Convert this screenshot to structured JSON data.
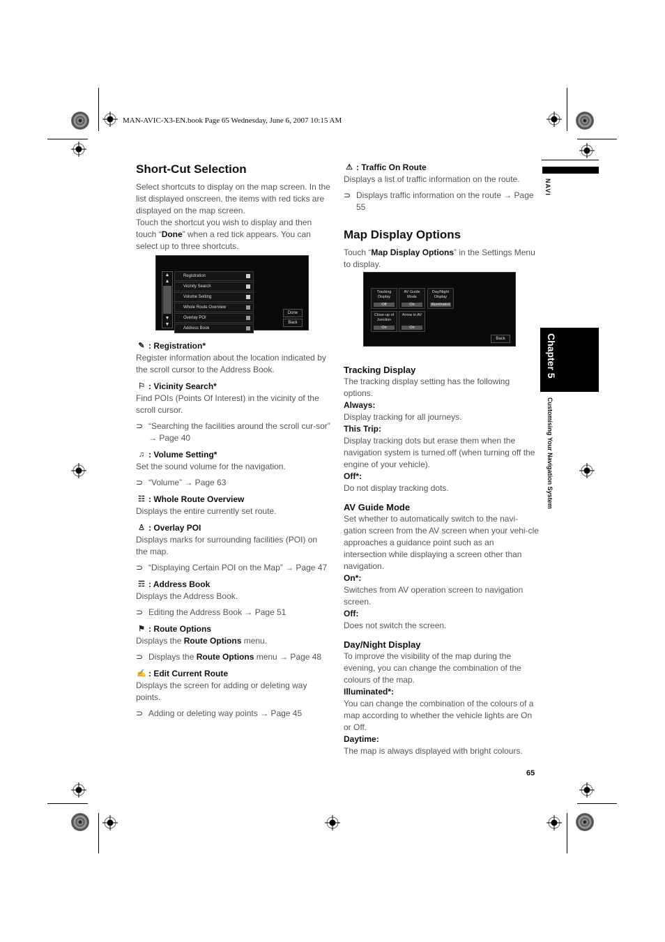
{
  "header": {
    "print_line": "MAN-AVIC-X3-EN.book  Page 65  Wednesday, June 6, 2007  10:15 AM"
  },
  "side": {
    "navi": "NAVI",
    "chapter": "Chapter 5",
    "section": "Customising Your Navigation System"
  },
  "page_number": "65",
  "shortcut": {
    "title": "Short-Cut Selection",
    "intro_1": "Select shortcuts to display on the map screen. In the list displayed onscreen, the items with red ticks are displayed on the map screen.",
    "intro_2_pre": "Touch the shortcut you wish to display and then touch “",
    "intro_2_bold": "Done",
    "intro_2_post": "” when a red tick appears. You can select up to three shortcuts.",
    "screen": {
      "rows": [
        {
          "label": "Registration",
          "checked": true
        },
        {
          "label": "Vicinity Search",
          "checked": true
        },
        {
          "label": "Volume Setting",
          "checked": true
        },
        {
          "label": "Whole Route Overview",
          "checked": false
        },
        {
          "label": "Overlay POI",
          "checked": false
        },
        {
          "label": "Address Book",
          "checked": false
        }
      ],
      "done": "Done",
      "back": "Back"
    },
    "items": [
      {
        "icon": "registration-icon",
        "glyph": "✎",
        "title": ": Registration*",
        "desc": "Register information about the location indicated by the scroll cursor to the Address Book."
      },
      {
        "icon": "vicinity-search-icon",
        "glyph": "⚐",
        "title": ": Vicinity Search*",
        "desc": "Find POIs (Points Of Interest) in the vicinity of the scroll cursor.",
        "ref": "“Searching the facilities around the scroll cur-sor” → Page 40"
      },
      {
        "icon": "volume-setting-icon",
        "glyph": "♫",
        "title": ": Volume Setting*",
        "desc": "Set the sound volume for the navigation.",
        "ref": "“Volume” → Page 63"
      },
      {
        "icon": "whole-route-overview-icon",
        "glyph": "☷",
        "title": ": Whole Route Overview",
        "desc": "Displays the entire currently set route."
      },
      {
        "icon": "overlay-poi-icon",
        "glyph": "♙",
        "title": " : Overlay POI",
        "desc": "Displays marks for surrounding facilities (POI) on the map.",
        "ref": "“Displaying Certain POI on the Map” → Page 47"
      },
      {
        "icon": "address-book-icon",
        "glyph": "☶",
        "title": ": Address Book",
        "desc": "Displays the Address Book.",
        "ref": "Editing the Address Book → Page 51"
      },
      {
        "icon": "route-options-icon",
        "glyph": "⚑",
        "title": ": Route Options",
        "desc_pre": "Displays the ",
        "desc_bold": "Route Options",
        "desc_post": " menu.",
        "ref_pre": "Displays the ",
        "ref_bold": "Route Options",
        "ref_post": " menu → Page 48"
      },
      {
        "icon": "edit-current-route-icon",
        "glyph": "✍",
        "title": ": Edit Current Route",
        "desc": "Displays the screen for adding or deleting way points.",
        "ref": "Adding or deleting way points → Page 45"
      }
    ]
  },
  "traffic": {
    "icon": "traffic-on-route-icon",
    "glyph": "⚠",
    "title": ": Traffic On Route",
    "desc": "Displays a list of traffic information on the route.",
    "ref": "Displays traffic information on the route → Page 55"
  },
  "map_display": {
    "title": "Map Display Options",
    "intro_pre": "Touch “",
    "intro_bold": "Map Display Options",
    "intro_post": "” in the Settings Menu to display.",
    "screen": {
      "tiles": [
        {
          "label": "Tracking Display",
          "value": "Off"
        },
        {
          "label": "AV Guide Mode",
          "value": "On"
        },
        {
          "label": "Day/Night Display",
          "value": "Illuminated"
        },
        {
          "label": "Close-up of Junction",
          "value": "On"
        },
        {
          "label": "Arrow in AV",
          "value": "On"
        }
      ],
      "back": "Back"
    },
    "tracking": {
      "title": "Tracking Display",
      "desc": "The tracking display setting has the following options.",
      "options": [
        {
          "name": "Always:",
          "desc": "Display tracking for all journeys."
        },
        {
          "name": "This Trip:",
          "desc": "Display tracking dots but erase them when the navigation system is turned off (when turning off the engine of your vehicle)."
        },
        {
          "name": "Off*:",
          "desc": "Do not display tracking dots."
        }
      ]
    },
    "av_guide": {
      "title": "AV Guide Mode",
      "desc": "Set whether to automatically switch to the navi-gation screen from the AV screen when your vehi-cle approaches a guidance point such as an intersection while displaying a screen other than navigation.",
      "options": [
        {
          "name": "On*:",
          "desc": "Switches from AV operation screen to navigation screen."
        },
        {
          "name": "Off:",
          "desc": "Does not switch the screen."
        }
      ]
    },
    "day_night": {
      "title": "Day/Night Display",
      "desc": "To improve the visibility of the map during the evening, you can change the combination of the colours of the map.",
      "options": [
        {
          "name": "Illuminated*:",
          "desc": "You can change the combination of the colours of a map according to whether the vehicle lights are On or Off."
        },
        {
          "name": "Daytime:",
          "desc": "The map is always displayed with bright colours."
        }
      ]
    }
  }
}
